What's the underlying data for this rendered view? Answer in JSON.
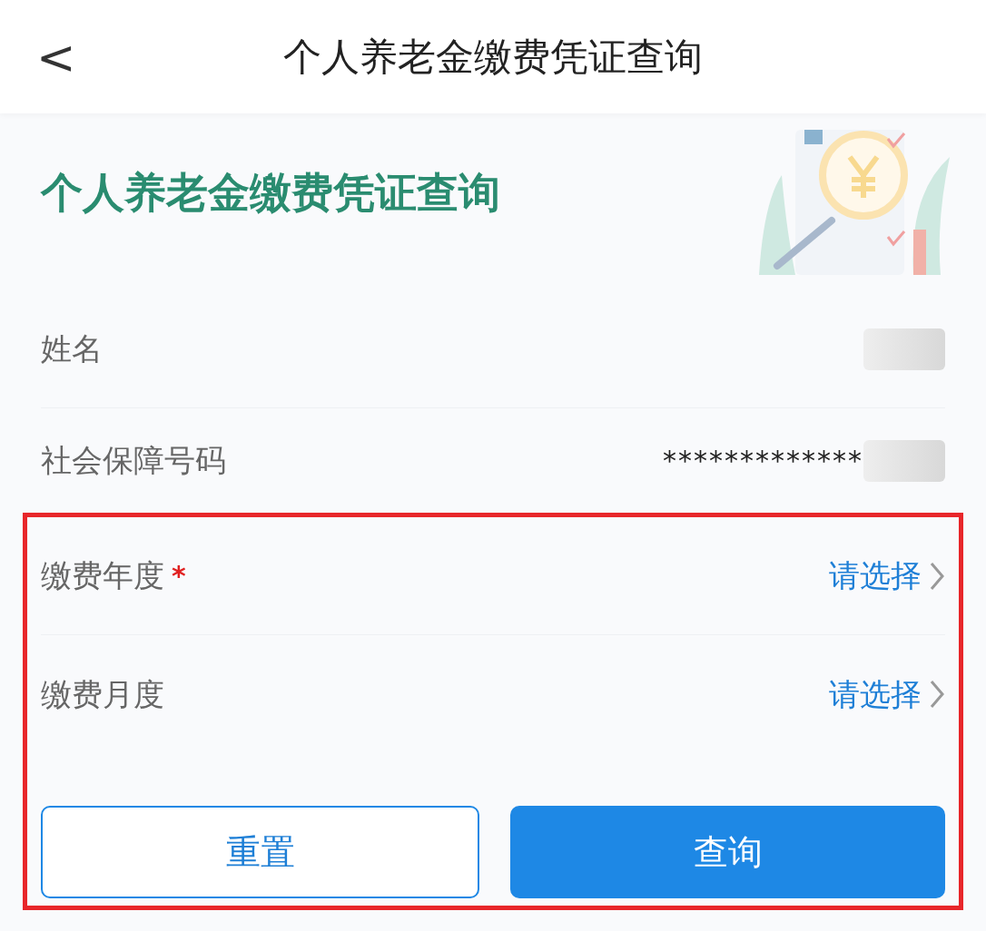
{
  "header": {
    "back": "<",
    "title": "个人养老金缴费凭证查询"
  },
  "required_mark": "*",
  "banner": {
    "title": "个人养老金缴费凭证查询"
  },
  "rows": [
    {
      "kind": "value",
      "label": "姓名",
      "redacted": true,
      "required": false
    },
    {
      "kind": "value",
      "label": "社会保障号码",
      "value": "*************",
      "redacted": true,
      "required": false
    },
    {
      "kind": "select",
      "label": "缴费年度",
      "value": "请选择",
      "redacted": false,
      "required": true
    },
    {
      "kind": "select",
      "label": "缴费月度",
      "value": "请选择",
      "redacted": false,
      "required": false
    }
  ],
  "buttons": [
    {
      "kind": "secondary",
      "label": "重置"
    },
    {
      "kind": "primary",
      "label": "查询"
    }
  ]
}
